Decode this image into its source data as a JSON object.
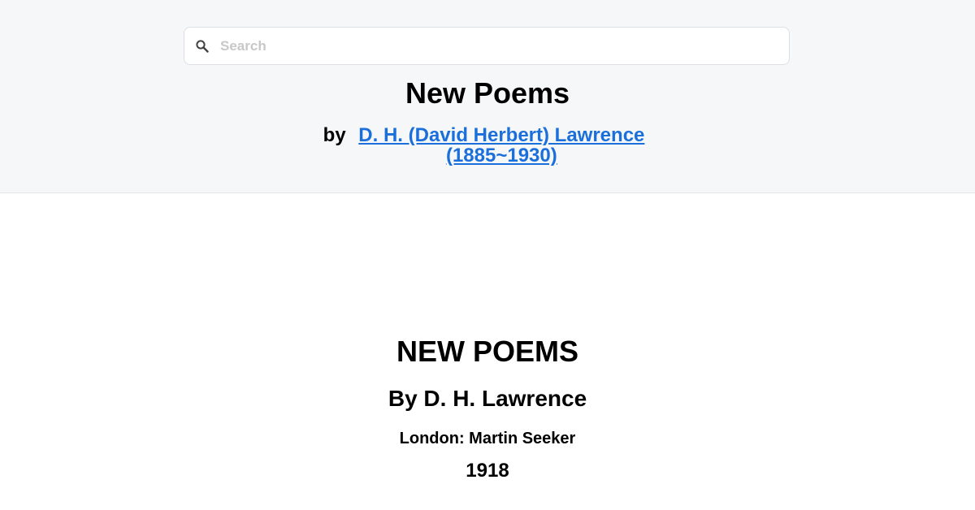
{
  "search": {
    "placeholder": "Search",
    "value": ""
  },
  "header": {
    "title": "New Poems",
    "by_label": "by",
    "author_link": "D. H. (David Herbert) Lawrence (1885~1930)"
  },
  "content": {
    "title": "NEW POEMS",
    "author": "By D. H. Lawrence",
    "publisher": "London: Martin Seeker",
    "year": "1918"
  },
  "colors": {
    "link": "#1a6fdb",
    "header_bg": "#f6f7f9"
  }
}
